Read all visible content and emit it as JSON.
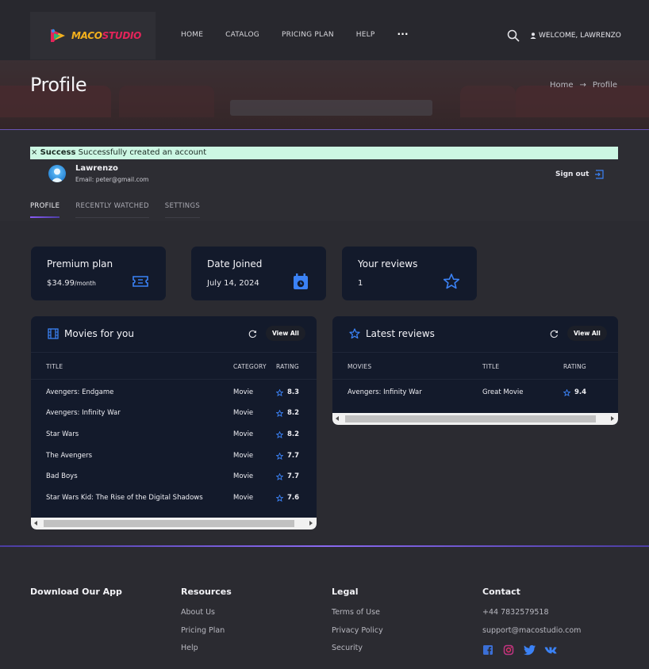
{
  "header": {
    "logo": {
      "part1": "MACO",
      "part2": "STUDIO"
    },
    "nav": [
      "HOME",
      "CATALOG",
      "PRICING PLAN",
      "HELP"
    ],
    "more_label": "···",
    "welcome": "WELCOME, LAWRENZO"
  },
  "hero": {
    "title": "Profile",
    "breadcrumb": {
      "home": "Home",
      "arrow": "→",
      "current": "Profile"
    }
  },
  "alert": {
    "marker": "×",
    "strong": "Success",
    "message": "Successfully created an account"
  },
  "user": {
    "name": "Lawrenzo",
    "email": "Email: peter@gmail.com",
    "signout": "Sign out"
  },
  "tabs": [
    "PROFILE",
    "RECENTLY WATCHED",
    "SETTINGS"
  ],
  "stats": {
    "plan": {
      "label": "Premium plan",
      "price": "$34.99",
      "period": "/month"
    },
    "joined": {
      "label": "Date Joined",
      "value": "July 14, 2024"
    },
    "reviews": {
      "label": "Your reviews",
      "value": "1"
    }
  },
  "movies_panel": {
    "title": "Movies for you",
    "view_all": "View All",
    "columns": [
      "TITLE",
      "CATEGORY",
      "RATING"
    ],
    "rows": [
      {
        "title": "Avengers: Endgame",
        "category": "Movie",
        "rating": "8.3"
      },
      {
        "title": "Avengers: Infinity War",
        "category": "Movie",
        "rating": "8.2"
      },
      {
        "title": "Star Wars",
        "category": "Movie",
        "rating": "8.2"
      },
      {
        "title": "The Avengers",
        "category": "Movie",
        "rating": "7.7"
      },
      {
        "title": "Bad Boys",
        "category": "Movie",
        "rating": "7.7"
      },
      {
        "title": "Star Wars Kid: The Rise of the Digital Shadows",
        "category": "Movie",
        "rating": "7.6"
      }
    ]
  },
  "reviews_panel": {
    "title": "Latest reviews",
    "view_all": "View All",
    "columns": [
      "MOVIES",
      "TITLE",
      "RATING"
    ],
    "rows": [
      {
        "movie": "Avengers: Infinity War",
        "title": "Great Movie",
        "rating": "9.4"
      }
    ]
  },
  "footer": {
    "app": {
      "heading": "Download Our App"
    },
    "resources": {
      "heading": "Resources",
      "links": [
        "About Us",
        "Pricing Plan",
        "Help"
      ]
    },
    "legal": {
      "heading": "Legal",
      "links": [
        "Terms of Use",
        "Privacy Policy",
        "Security"
      ]
    },
    "contact": {
      "heading": "Contact",
      "phone": "+44 7832579518",
      "email": "support@macostudio.com"
    },
    "social_icons": [
      "facebook-icon",
      "instagram-icon",
      "twitter-icon",
      "vk-icon"
    ]
  },
  "colors": {
    "accent": "#3b82f6",
    "panel": "#131a2b",
    "bg": "#2b2b31",
    "alert_bg": "#ccf7e3"
  }
}
